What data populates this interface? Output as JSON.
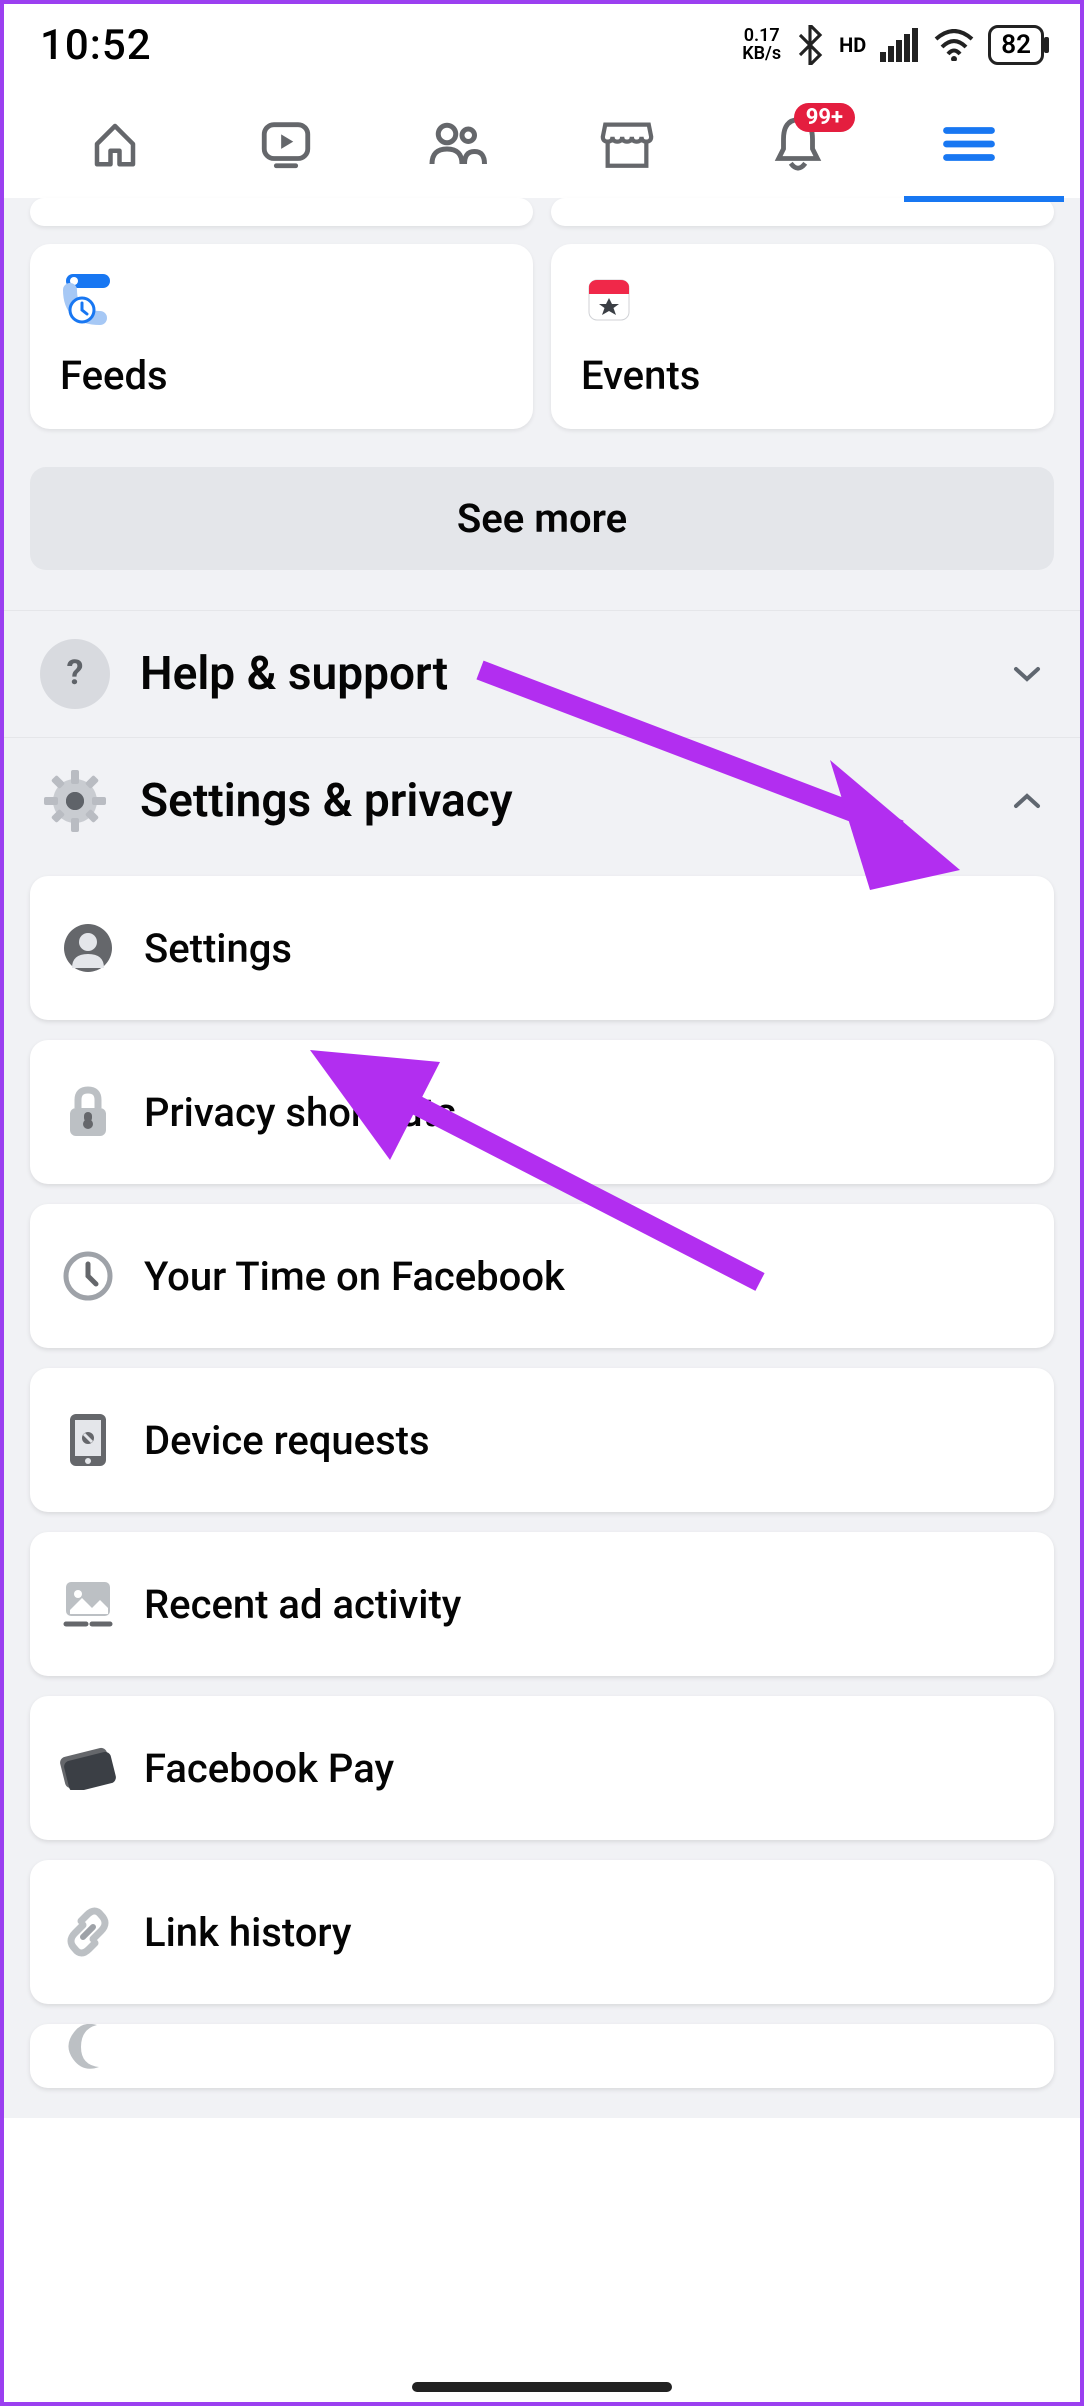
{
  "status": {
    "time": "10:52",
    "net_speed_top": "0.17",
    "net_speed_bottom": "KB/s",
    "hd": "HD",
    "battery": "82"
  },
  "nav": {
    "notif_badge": "99+"
  },
  "shortcuts": {
    "feeds": "Feeds",
    "events": "Events",
    "see_more": "See more"
  },
  "sections": {
    "help": "Help & support",
    "settings_privacy": "Settings & privacy"
  },
  "settings": {
    "settings": "Settings",
    "privacy_shortcuts": "Privacy shortcuts",
    "your_time": "Your Time on Facebook",
    "device_requests": "Device requests",
    "recent_ad": "Recent ad activity",
    "facebook_pay": "Facebook Pay",
    "link_history": "Link history"
  }
}
